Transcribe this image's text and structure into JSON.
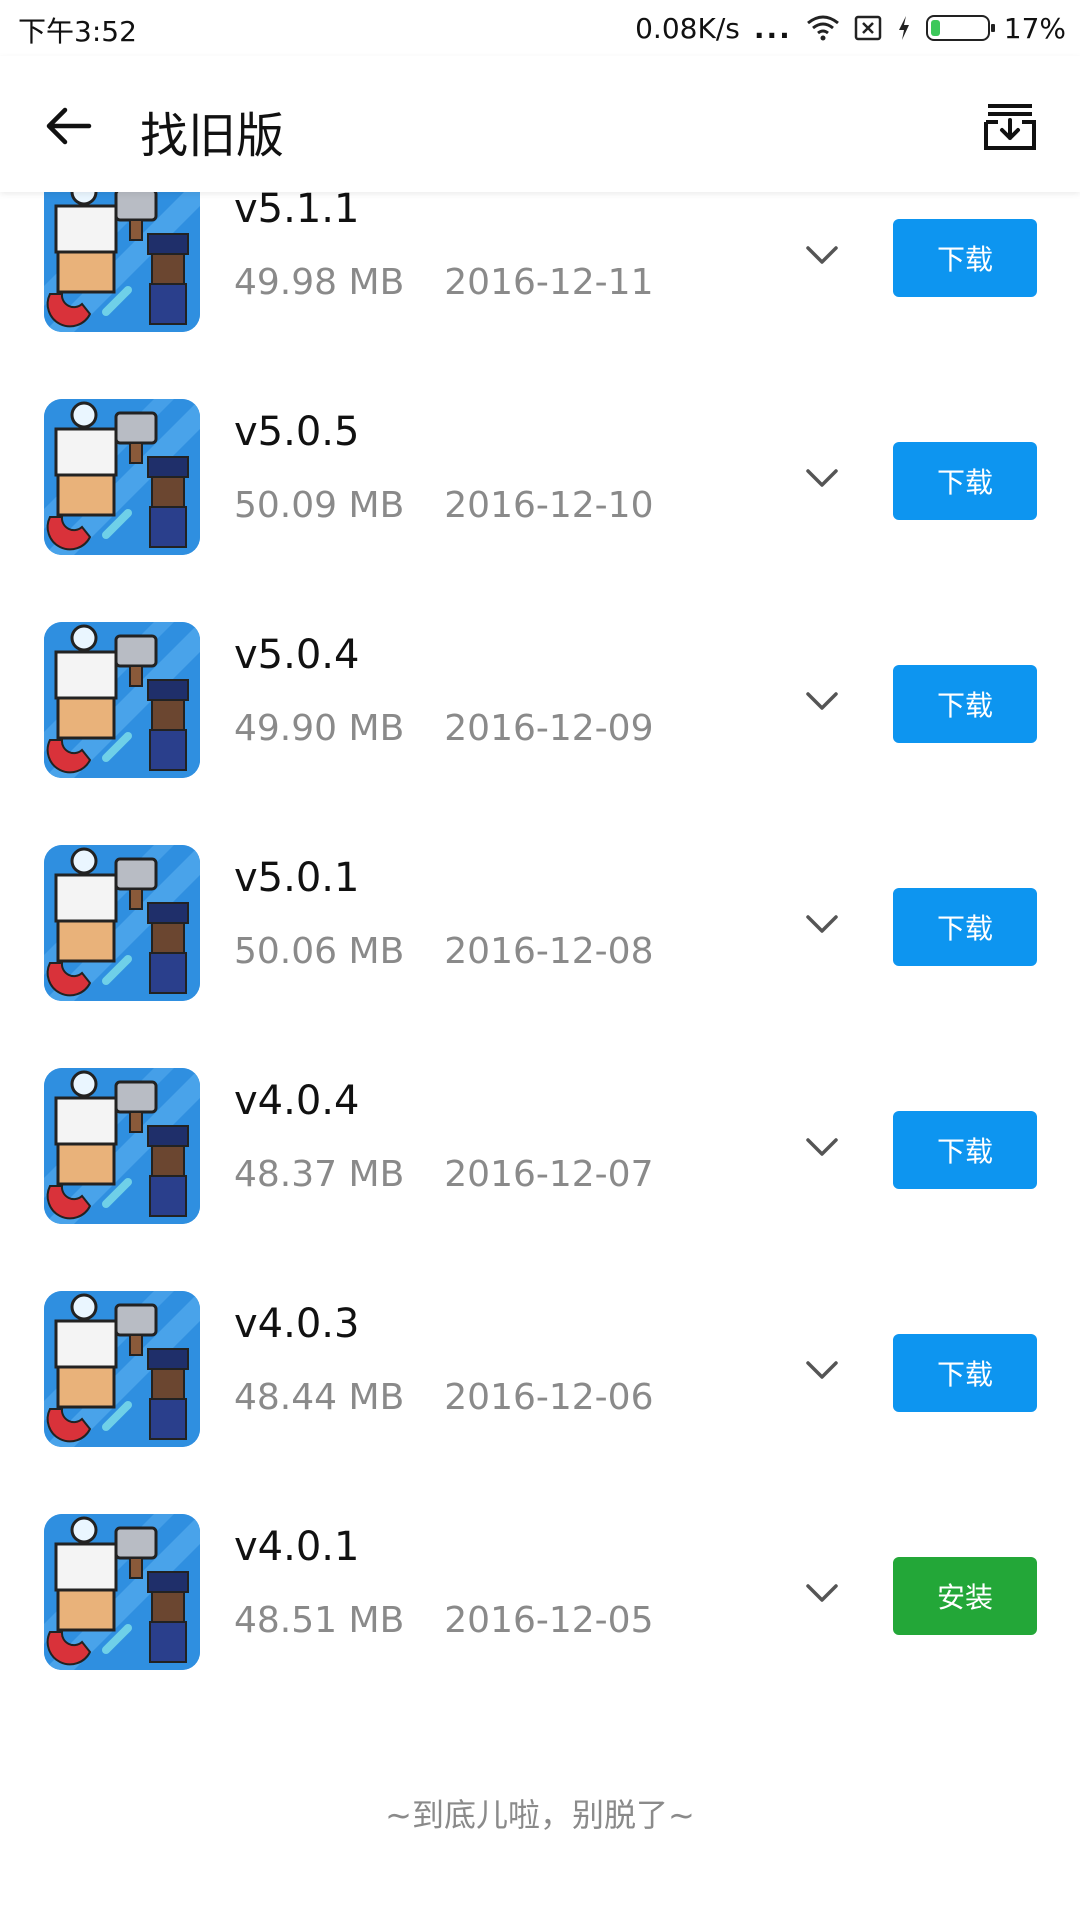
{
  "status_bar": {
    "time": "下午3:52",
    "net_speed": "0.08K/s",
    "dots": "...",
    "battery_pct": "17%",
    "battery_level": 0.17,
    "icons": [
      "wifi-icon",
      "sim-none-icon",
      "charging-icon",
      "battery-icon"
    ]
  },
  "header": {
    "title": "找旧版",
    "back_icon": "arrow-left-icon",
    "download_manager_icon": "download-tray-icon"
  },
  "versions": [
    {
      "version": "v5.1.1",
      "size": "49.98 MB",
      "date": "2016-12-11",
      "action": "下载",
      "action_type": "download"
    },
    {
      "version": "v5.0.5",
      "size": "50.09 MB",
      "date": "2016-12-10",
      "action": "下载",
      "action_type": "download"
    },
    {
      "version": "v5.0.4",
      "size": "49.90 MB",
      "date": "2016-12-09",
      "action": "下载",
      "action_type": "download"
    },
    {
      "version": "v5.0.1",
      "size": "50.06 MB",
      "date": "2016-12-08",
      "action": "下载",
      "action_type": "download"
    },
    {
      "version": "v4.0.4",
      "size": "48.37 MB",
      "date": "2016-12-07",
      "action": "下载",
      "action_type": "download"
    },
    {
      "version": "v4.0.3",
      "size": "48.44 MB",
      "date": "2016-12-06",
      "action": "下载",
      "action_type": "download"
    },
    {
      "version": "v4.0.1",
      "size": "48.51 MB",
      "date": "2016-12-05",
      "action": "安装",
      "action_type": "install"
    }
  ],
  "footer": {
    "text": "~到底儿啦，别脱了~"
  },
  "colors": {
    "download_button": "#0d95f0",
    "install_button": "#23a738",
    "meta_text": "#8a8a8a"
  }
}
